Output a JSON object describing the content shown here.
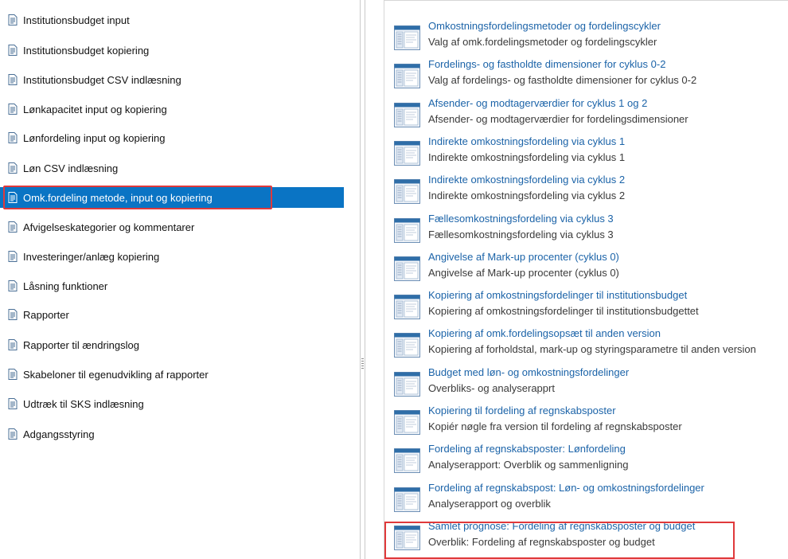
{
  "nav": {
    "items": [
      {
        "label": "Institutionsbudget input",
        "selected": false
      },
      {
        "label": "Institutionsbudget kopiering",
        "selected": false
      },
      {
        "label": "Institutionsbudget CSV indlæsning",
        "selected": false
      },
      {
        "label": "Lønkapacitet input og kopiering",
        "selected": false
      },
      {
        "label": "Lønfordeling input og kopiering",
        "selected": false
      },
      {
        "label": "Løn CSV indlæsning",
        "selected": false
      },
      {
        "label": "Omk.fordeling metode, input og kopiering",
        "selected": true
      },
      {
        "label": "Afvigelseskategorier og kommentarer",
        "selected": false
      },
      {
        "label": "Investeringer/anlæg kopiering",
        "selected": false
      },
      {
        "label": "Låsning funktioner",
        "selected": false
      },
      {
        "label": "Rapporter",
        "selected": false
      },
      {
        "label": "Rapporter til ændringslog",
        "selected": false
      },
      {
        "label": "Skabeloner til egenudvikling af rapporter",
        "selected": false
      },
      {
        "label": "Udtræk til SKS indlæsning",
        "selected": false
      },
      {
        "label": "Adgangsstyring",
        "selected": false
      }
    ]
  },
  "reports": {
    "items": [
      {
        "title": "Omkostningsfordelingsmetoder og fordelingscykler",
        "desc": "Valg af omk.fordelingsmetoder og fordelingscykler"
      },
      {
        "title": "Fordelings- og fastholdte dimensioner for cyklus 0-2",
        "desc": "Valg af fordelings- og fastholdte dimensioner for cyklus 0-2"
      },
      {
        "title": "Afsender- og modtagerværdier for cyklus 1 og 2",
        "desc": "Afsender- og modtagerværdier for fordelingsdimensioner"
      },
      {
        "title": "Indirekte omkostningsfordeling via cyklus 1",
        "desc": "Indirekte omkostningsfordeling via cyklus 1"
      },
      {
        "title": "Indirekte omkostningsfordeling via cyklus 2",
        "desc": "Indirekte omkostningsfordeling via cyklus 2"
      },
      {
        "title": "Fællesomkostningsfordeling via cyklus 3",
        "desc": "Fællesomkostningsfordeling via cyklus 3"
      },
      {
        "title": "Angivelse af Mark-up procenter (cyklus 0)",
        "desc": "Angivelse af Mark-up procenter (cyklus 0)"
      },
      {
        "title": "Kopiering af omkostningsfordelinger til institutionsbudget",
        "desc": "Kopiering af omkostningsfordelinger til institutionsbudgettet"
      },
      {
        "title": "Kopiering af omk.fordelingsopsæt til anden version",
        "desc": "Kopiering af forholdstal, mark-up og styringsparametre til anden version"
      },
      {
        "title": "Budget med løn- og omkostningsfordelinger",
        "desc": "Overbliks- og analyserappr​t"
      },
      {
        "title": "Kopiering til fordeling af regnskabsposter",
        "desc": "Kopiér nøgle fra version til fordeling af regnskabsposter"
      },
      {
        "title": "Fordeling af regnskabsposter: Lønfordeling",
        "desc": "Analyserapport: Overblik og sammenligning"
      },
      {
        "title": "Fordeling af regnskabspost: Løn- og omkostningsfordelinger",
        "desc": "Analyserapport og overblik"
      },
      {
        "title": "Samlet prognose: Fordeling af regnskabsposter og budget",
        "desc": "Overblik: Fordeling af regnskabsposter og budget"
      }
    ]
  },
  "colors": {
    "selected_bg": "#0a74c4",
    "highlight_outline": "#e0393b",
    "link_blue": "#1b63a8"
  }
}
